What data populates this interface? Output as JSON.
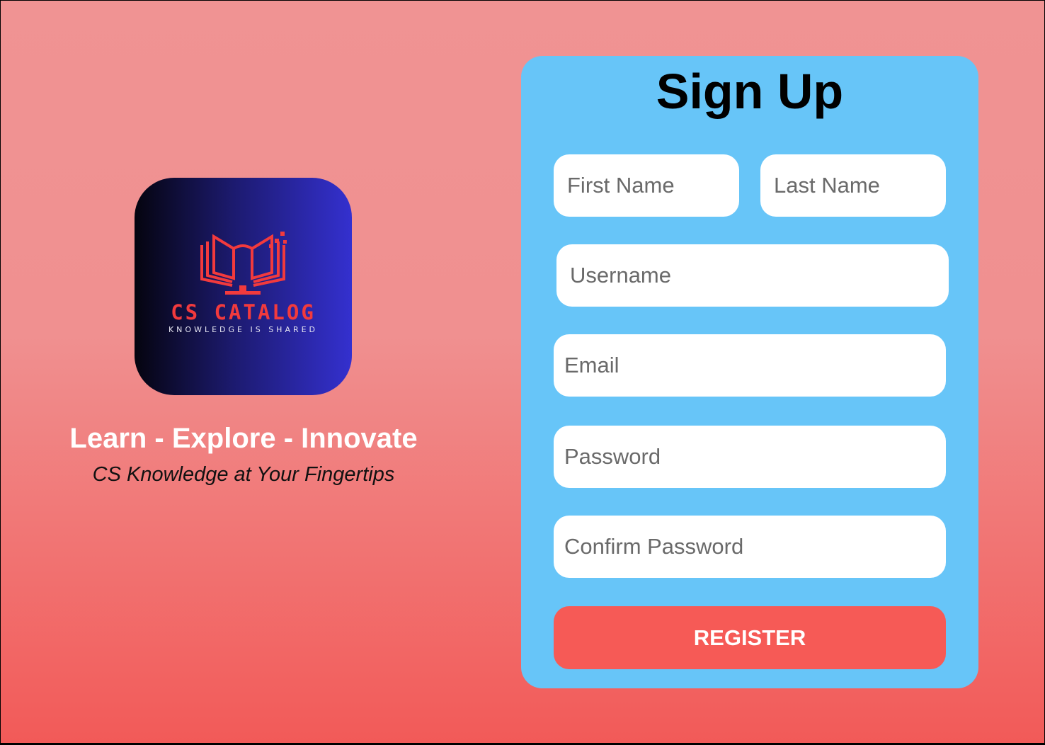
{
  "brand": {
    "logo_name": "CS CATALOG",
    "logo_tagline": "KNOWLEDGE IS SHARED",
    "slogan": "Learn - Explore - Innovate",
    "subslogan": "CS Knowledge at Your Fingertips",
    "logo_icon": "book-monitor-icon"
  },
  "signup": {
    "title": "Sign Up",
    "fields": {
      "first_name": "First Name",
      "last_name": "Last Name",
      "username": "Username",
      "email": "Email",
      "password": "Password",
      "confirm_password": "Confirm Password"
    },
    "register_label": "REGISTER"
  },
  "colors": {
    "background_top": "#f09393",
    "background_bottom": "#f25a58",
    "card": "#67c5f8",
    "button": "#f65a56",
    "logo_accent": "#f23a3d"
  }
}
